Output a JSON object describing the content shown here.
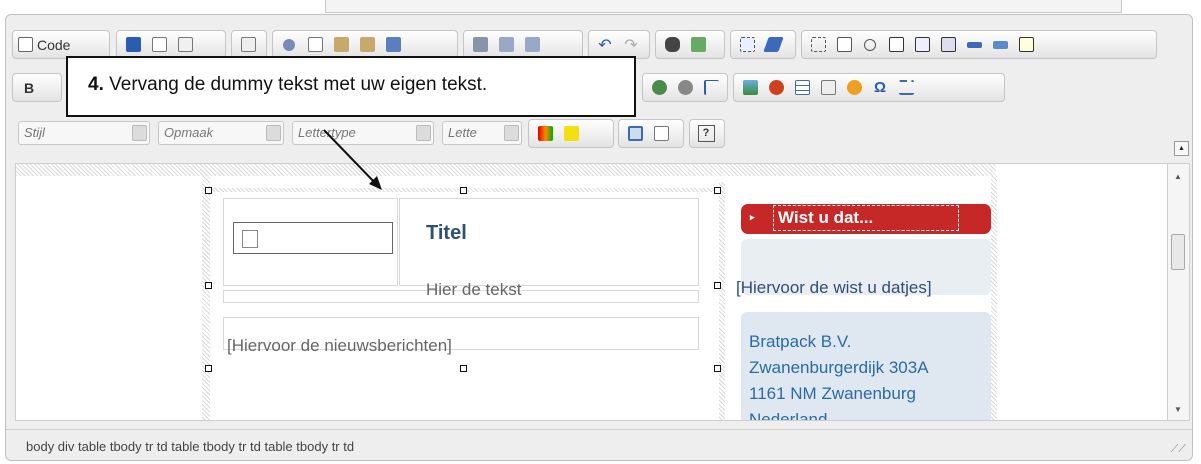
{
  "toolbar": {
    "code_label": "Code",
    "bold_label": "B",
    "help_label": "?",
    "omega_label": "Ω",
    "combos": {
      "style": "Stijl",
      "format": "Opmaak",
      "font": "Lettertype",
      "size": "Lette"
    }
  },
  "callout": {
    "step": "4.",
    "text": " Vervang de dummy tekst met uw eigen tekst."
  },
  "content": {
    "title": "Titel",
    "body_text": "Hier de tekst",
    "news_placeholder": "[Hiervoor de nieuwsberichten]",
    "wist_header": "Wist u dat...",
    "wist_placeholder": "[Hiervoor de wist u datjes]",
    "address": [
      "Bratpack B.V.",
      "Zwanenburgerdijk 303A",
      "1161 NM Zwanenburg",
      "Nederland"
    ]
  },
  "statusbar": {
    "path": "body  div  table  tbody  tr  td  table  tbody  tr  td  table  tbody  tr  td"
  },
  "colors": {
    "accent_red": "#c62828",
    "link_blue": "#2a6aa8",
    "title_blue": "#2f4f7a"
  }
}
